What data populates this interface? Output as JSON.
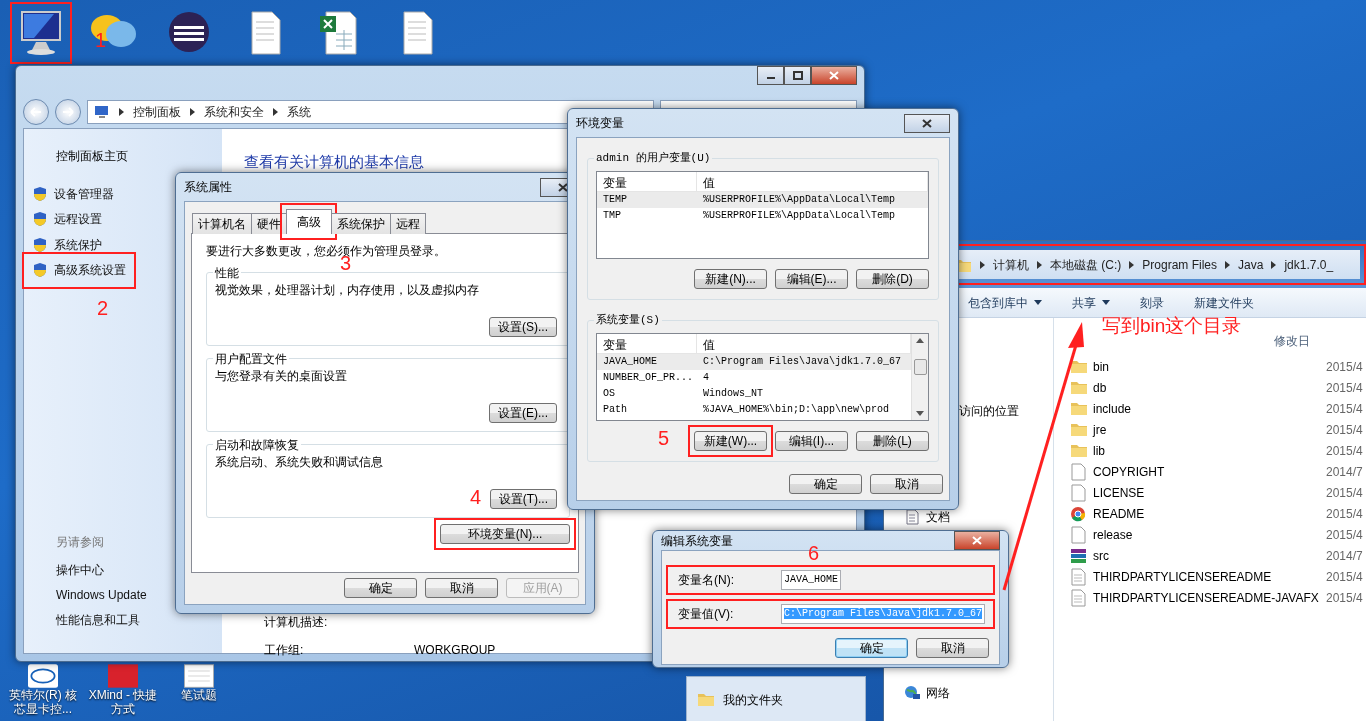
{
  "desktop": {
    "computer_icon": {
      "highlighted": true
    },
    "shortcuts": [
      {
        "label": "英特尔(R) 核芯显卡控..."
      },
      {
        "label": "XMind - 快捷方式"
      },
      {
        "label": "笔试题"
      }
    ]
  },
  "control_panel": {
    "breadcrumb": [
      "控制面板",
      "系统和安全",
      "系统"
    ],
    "sidebar": {
      "home": "控制面板主页",
      "items": [
        {
          "label": "设备管理器",
          "highlighted": false
        },
        {
          "label": "远程设置",
          "highlighted": false
        },
        {
          "label": "系统保护",
          "highlighted": false
        },
        {
          "label": "高级系统设置",
          "highlighted": true
        }
      ],
      "see_also_title": "另请参阅",
      "see_also": [
        "操作中心",
        "Windows Update",
        "性能信息和工具"
      ]
    },
    "heading": "查看有关计算机的基本信息",
    "fields": [
      {
        "label": "计算机描述:"
      },
      {
        "label": "工作组:",
        "value": "WORKGROUP"
      }
    ]
  },
  "background_window": {
    "item": "我的文件夹"
  },
  "explorer": {
    "breadcrumb": [
      "计算机",
      "本地磁盘 (C:)",
      "Program Files",
      "Java",
      "jdk1.7.0_"
    ],
    "breadcrumb_highlighted": true,
    "toolbar": [
      {
        "label": "包含到库中",
        "dropdown": true
      },
      {
        "label": "共享",
        "dropdown": true
      },
      {
        "label": "刻录",
        "dropdown": false
      },
      {
        "label": "新建文件夹",
        "dropdown": false
      }
    ],
    "column_header": "修改日",
    "nav": [
      "访问的位置",
      "文档",
      "网络"
    ],
    "files": [
      {
        "name": "bin",
        "kind": "folder",
        "modified": "2015/4"
      },
      {
        "name": "db",
        "kind": "folder",
        "modified": "2015/4"
      },
      {
        "name": "include",
        "kind": "folder",
        "modified": "2015/4"
      },
      {
        "name": "jre",
        "kind": "folder",
        "modified": "2015/4"
      },
      {
        "name": "lib",
        "kind": "folder",
        "modified": "2015/4"
      },
      {
        "name": "COPYRIGHT",
        "kind": "file",
        "modified": "2014/7"
      },
      {
        "name": "LICENSE",
        "kind": "file",
        "modified": "2015/4"
      },
      {
        "name": "README",
        "kind": "web",
        "modified": "2015/4"
      },
      {
        "name": "release",
        "kind": "file",
        "modified": "2015/4"
      },
      {
        "name": "src",
        "kind": "archive",
        "modified": "2014/7"
      },
      {
        "name": "THIRDPARTYLICENSEREADME",
        "kind": "text",
        "modified": "2015/4"
      },
      {
        "name": "THIRDPARTYLICENSEREADME-JAVAFX",
        "kind": "text",
        "modified": "2015/4"
      }
    ]
  },
  "system_properties": {
    "title": "系统属性",
    "tabs": [
      {
        "label": "计算机名",
        "selected": false,
        "highlighted": false
      },
      {
        "label": "硬件",
        "selected": false,
        "highlighted": false
      },
      {
        "label": "高级",
        "selected": true,
        "highlighted": true
      },
      {
        "label": "系统保护",
        "selected": false,
        "highlighted": false
      },
      {
        "label": "远程",
        "selected": false,
        "highlighted": false
      }
    ],
    "note": "要进行大多数更改，您必须作为管理员登录。",
    "groups": [
      {
        "title": "性能",
        "description": "视觉效果，处理器计划，内存使用，以及虚拟内存",
        "button": "设置(S)..."
      },
      {
        "title": "用户配置文件",
        "description": "与您登录有关的桌面设置",
        "button": "设置(E)..."
      },
      {
        "title": "启动和故障恢复",
        "description": "系统启动、系统失败和调试信息",
        "button": "设置(T)..."
      }
    ],
    "env_button": {
      "label": "环境变量(N)...",
      "highlighted": true
    },
    "buttons": [
      {
        "label": "确定",
        "disabled": false
      },
      {
        "label": "取消",
        "disabled": false
      },
      {
        "label": "应用(A)",
        "disabled": true
      }
    ]
  },
  "environment_variables": {
    "title": "环境变量",
    "sections": [
      {
        "title": "admin 的用户变量(U)",
        "columns": [
          "变量",
          "值"
        ],
        "rows": [
          {
            "name": "TEMP",
            "value": "%USERPROFILE%\\AppData\\Local\\Temp",
            "selected": true
          },
          {
            "name": "TMP",
            "value": "%USERPROFILE%\\AppData\\Local\\Temp",
            "selected": false
          }
        ],
        "buttons": [
          {
            "label": "新建(N)...",
            "highlighted": false
          },
          {
            "label": "编辑(E)...",
            "highlighted": false
          },
          {
            "label": "删除(D)",
            "highlighted": false
          }
        ]
      },
      {
        "title": "系统变量(S)",
        "columns": [
          "变量",
          "值"
        ],
        "rows": [
          {
            "name": "JAVA_HOME",
            "value": "C:\\Program Files\\Java\\jdk1.7.0_67",
            "selected": true
          },
          {
            "name": "NUMBER_OF_PR...",
            "value": "4",
            "selected": false
          },
          {
            "name": "OS",
            "value": "Windows_NT",
            "selected": false
          },
          {
            "name": "Path",
            "value": "%JAVA_HOME%\\bin;D:\\app\\new\\prod",
            "selected": false
          }
        ],
        "buttons": [
          {
            "label": "新建(W)...",
            "highlighted": true
          },
          {
            "label": "编辑(I)...",
            "highlighted": false
          },
          {
            "label": "删除(L)",
            "highlighted": false
          }
        ]
      }
    ],
    "buttons": [
      "确定",
      "取消"
    ]
  },
  "edit_variable": {
    "title": "编辑系统变量",
    "fields": [
      {
        "label": "变量名(N):",
        "value": "JAVA_HOME",
        "highlighted": true,
        "value_selected": false
      },
      {
        "label": "变量值(V):",
        "value": "C:\\Program Files\\Java\\jdk1.7.0_67",
        "highlighted": true,
        "value_selected": true
      }
    ],
    "buttons": [
      {
        "label": "确定",
        "default": true
      },
      {
        "label": "取消",
        "default": false
      }
    ]
  },
  "annotations": {
    "callouts": [
      "1",
      "2",
      "3",
      "4",
      "5",
      "6"
    ],
    "note": "写到bin这个目录"
  }
}
